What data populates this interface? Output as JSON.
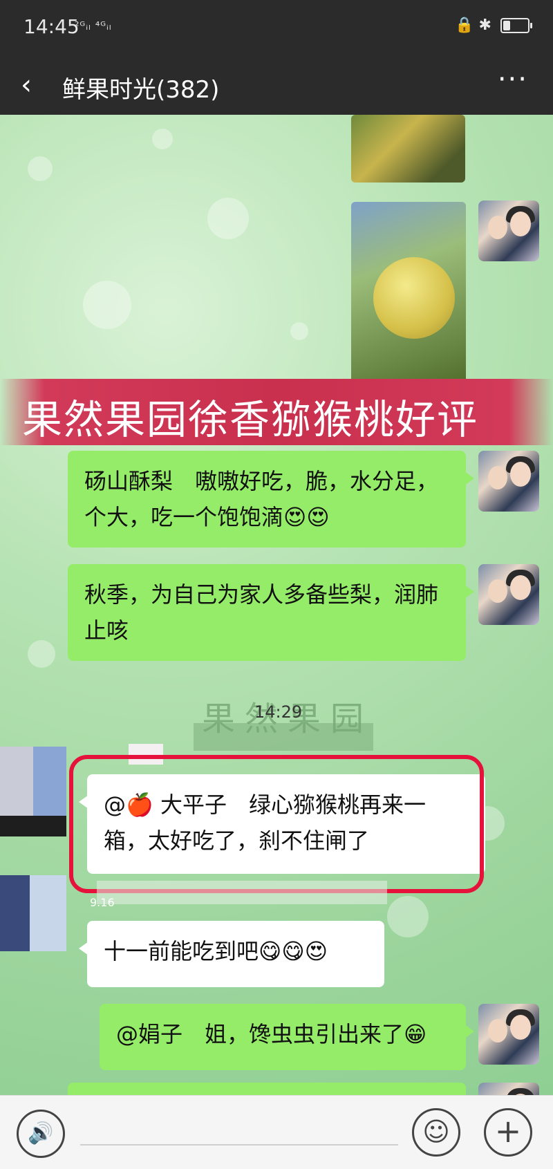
{
  "status_bar": {
    "time": "14:45",
    "signal": "²ᴳᵢₗ ⁴ᴳᵢₗ",
    "right_icons": "🔒 ✱"
  },
  "header": {
    "back": "‹",
    "title": "鲜果时光(382)",
    "more": "···"
  },
  "banner": {
    "text": "果然果园徐香猕猴桃好评"
  },
  "messages": {
    "m1": "砀山酥梨　嗷嗷好吃，脆，水分足，个大，吃一个饱饱滴😍😍",
    "m2": "秋季，为自己为家人多备些梨，润肺止咳",
    "timestamp": "14:29",
    "watermark": "果然果园",
    "m3": "@🍎 大平子　绿心猕猴桃再来一箱，太好吃了，刹不住闸了",
    "sender2": "9.16",
    "m4": "十一前能吃到吧😋😋😍",
    "m5": "@娟子　姐，馋虫虫引出来了😁"
  },
  "input_bar": {
    "voice": "🔊",
    "emoji": "☺",
    "plus": "+"
  },
  "colors": {
    "bubble_green": "#95ec69",
    "highlight": "#e5133c",
    "bar": "#2b2b2b"
  }
}
